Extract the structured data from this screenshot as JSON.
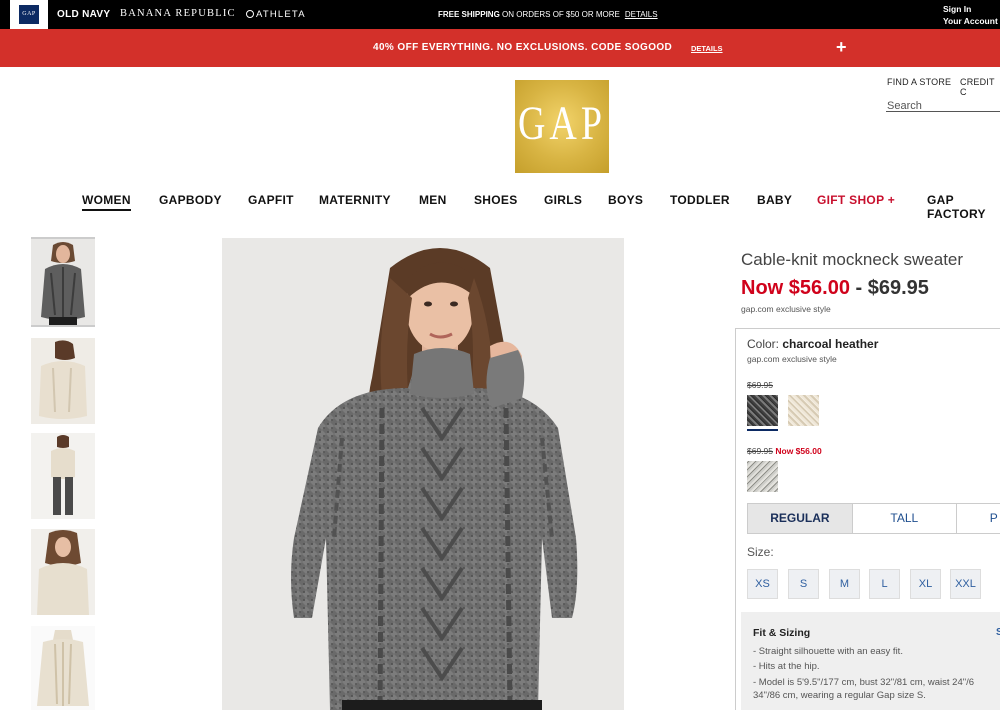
{
  "topbar": {
    "gap_logo": "GAP",
    "brands": [
      "OLD NAVY",
      "BANANA REPUBLIC",
      "ATHLETA"
    ],
    "shipping_bold": "FREE SHIPPING",
    "shipping_rest": " ON ORDERS OF $50 OR MORE",
    "shipping_details": "DETAILS",
    "sign_in": "Sign In",
    "your_account": "Your Account"
  },
  "promo": {
    "text": "40% OFF EVERYTHING. NO EXCLUSIONS. CODE SOGOOD",
    "details": "DETAILS",
    "expand": "+"
  },
  "header": {
    "logo": "GAP",
    "find_store": "FIND A STORE",
    "credit": "CREDIT C",
    "search_placeholder": "Search"
  },
  "nav": [
    "WOMEN",
    "GAPBODY",
    "GAPFIT",
    "MATERNITY",
    "MEN",
    "SHOES",
    "GIRLS",
    "BOYS",
    "TODDLER",
    "BABY",
    "GIFT SHOP +",
    "GAP FACTORY"
  ],
  "product": {
    "title": "Cable-knit mockneck sweater",
    "price_now": "Now $56.00",
    "price_sep": " - ",
    "price_high": "$69.95",
    "exclusive": "gap.com exclusive style",
    "color_label": "Color: ",
    "color_value": "charcoal heather",
    "color_exclusive": "gap.com exclusive style",
    "swatch_group_1_price": "$69.95",
    "swatch_group_2_orig": "$69.95",
    "swatch_group_2_now": "Now $56.00",
    "swatches": [
      "charcoal-heather",
      "ivory",
      "light-grey-marl"
    ],
    "fit_tabs": [
      "REGULAR",
      "TALL",
      "P"
    ],
    "size_label": "Size:",
    "sizes": [
      "XS",
      "S",
      "M",
      "L",
      "XL",
      "XXL"
    ],
    "fit_sizing_title": "Fit & Sizing",
    "fit_sizing_link": "S",
    "fit_lines": [
      "- Straight silhouette with an easy fit.",
      "- Hits at the hip.",
      "- Model is 5'9.5\"/177 cm, bust 32\"/81 cm, waist 24\"/6",
      "  34\"/86 cm, wearing a regular Gap size S."
    ]
  },
  "colors": {
    "promo_red": "#d3302a",
    "price_red": "#d0021b",
    "navy": "#0c2a63",
    "gold": "#d8b443"
  }
}
